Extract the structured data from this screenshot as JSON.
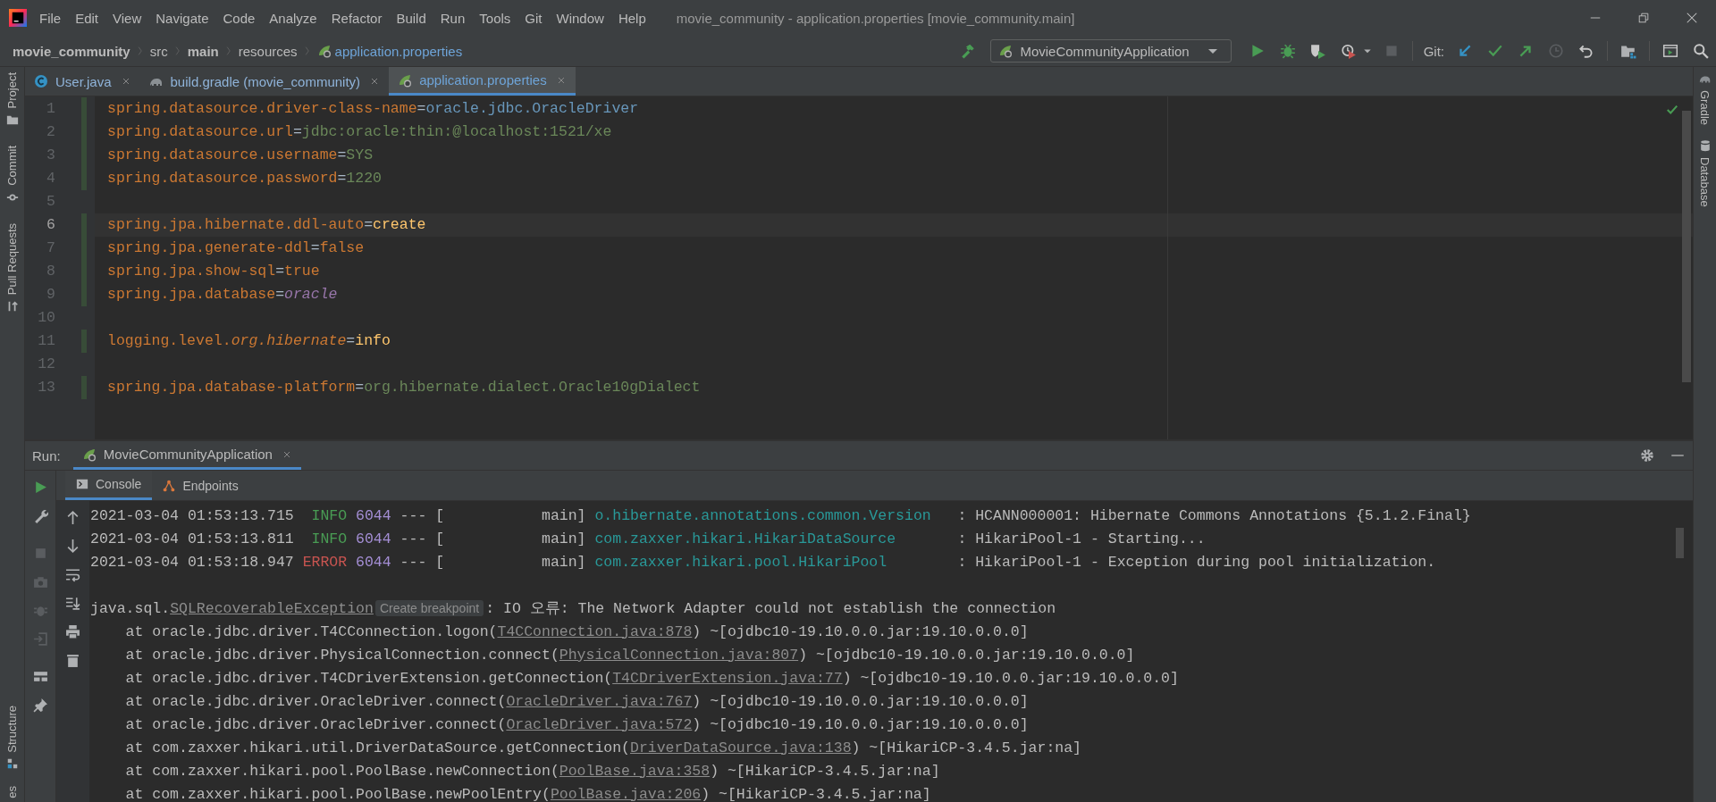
{
  "window": {
    "title": "movie_community - application.properties [movie_community.main]"
  },
  "menu": [
    "File",
    "Edit",
    "View",
    "Navigate",
    "Code",
    "Analyze",
    "Refactor",
    "Build",
    "Run",
    "Tools",
    "Git",
    "Window",
    "Help"
  ],
  "breadcrumbs": [
    {
      "label": "movie_community",
      "kind": "module"
    },
    {
      "label": "src",
      "kind": "folder"
    },
    {
      "label": "main",
      "kind": "source-set"
    },
    {
      "label": "resources",
      "kind": "folder"
    },
    {
      "label": "application.properties",
      "kind": "file"
    }
  ],
  "toolbar": {
    "run_configuration": "MovieCommunityApplication",
    "git_label": "Git:"
  },
  "left_stripe": [
    {
      "label": "Project"
    },
    {
      "label": "Commit"
    },
    {
      "label": "Pull Requests"
    },
    {
      "label": "Structure"
    },
    {
      "label": "es"
    }
  ],
  "right_stripe": [
    {
      "label": "Gradle"
    },
    {
      "label": "Database"
    }
  ],
  "editor_tabs": [
    {
      "label": "User.java",
      "kind": "java-class",
      "selected": false
    },
    {
      "label": "build.gradle (movie_community)",
      "kind": "gradle",
      "selected": false
    },
    {
      "label": "application.properties",
      "kind": "spring",
      "selected": true
    }
  ],
  "editor": {
    "lines": [
      {
        "number": "1",
        "modified": true,
        "selected": false,
        "segments": [
          {
            "text": "spring.datasource.driver-class-name",
            "kind": "key"
          },
          {
            "text": "=",
            "kind": "sep"
          },
          {
            "text": "oracle.jdbc.OracleDriver",
            "kind": "class"
          }
        ]
      },
      {
        "number": "2",
        "modified": true,
        "selected": false,
        "segments": [
          {
            "text": "spring.datasource.url",
            "kind": "key"
          },
          {
            "text": "=",
            "kind": "sep"
          },
          {
            "text": "jdbc:oracle:thin:@localhost:1521/xe",
            "kind": "value"
          }
        ]
      },
      {
        "number": "3",
        "modified": true,
        "selected": false,
        "segments": [
          {
            "text": "spring.datasource.username",
            "kind": "key"
          },
          {
            "text": "=",
            "kind": "sep"
          },
          {
            "text": "SYS",
            "kind": "value"
          }
        ]
      },
      {
        "number": "4",
        "modified": true,
        "selected": false,
        "segments": [
          {
            "text": "spring.datasource.password",
            "kind": "key"
          },
          {
            "text": "=",
            "kind": "sep"
          },
          {
            "text": "1220",
            "kind": "value"
          }
        ]
      },
      {
        "number": "5",
        "modified": false,
        "selected": false
      },
      {
        "number": "6",
        "modified": true,
        "selected": true,
        "segments": [
          {
            "text": "spring.jpa.hibernate.ddl-auto",
            "kind": "key"
          },
          {
            "text": "=",
            "kind": "sep"
          },
          {
            "text": "create",
            "kind": "keyword"
          }
        ]
      },
      {
        "number": "7",
        "modified": true,
        "selected": false,
        "segments": [
          {
            "text": "spring.jpa.generate-ddl",
            "kind": "key"
          },
          {
            "text": "=",
            "kind": "sep"
          },
          {
            "text": "false",
            "kind": "bool"
          }
        ]
      },
      {
        "number": "8",
        "modified": true,
        "selected": false,
        "segments": [
          {
            "text": "spring.jpa.show-sql",
            "kind": "key"
          },
          {
            "text": "=",
            "kind": "sep"
          },
          {
            "text": "true",
            "kind": "bool"
          }
        ]
      },
      {
        "number": "9",
        "modified": true,
        "selected": false,
        "segments": [
          {
            "text": "spring.jpa.database",
            "kind": "key"
          },
          {
            "text": "=",
            "kind": "sep"
          },
          {
            "text": "oracle",
            "kind": "enum"
          }
        ]
      },
      {
        "number": "10",
        "modified": false,
        "selected": false
      },
      {
        "number": "11",
        "modified": true,
        "selected": false,
        "segments": [
          {
            "text": "logging.level.",
            "kind": "key"
          },
          {
            "text": "org.hibernate",
            "kind": "key-italic"
          },
          {
            "text": "=",
            "kind": "sep"
          },
          {
            "text": "info",
            "kind": "keyword"
          }
        ]
      },
      {
        "number": "12",
        "modified": false,
        "selected": false
      },
      {
        "number": "13",
        "modified": true,
        "selected": false,
        "segments": [
          {
            "text": "spring.jpa.database-platform",
            "kind": "key"
          },
          {
            "text": "=",
            "kind": "sep"
          },
          {
            "text": "org.hibernate.dialect.Oracle10gDialect",
            "kind": "value"
          }
        ]
      }
    ]
  },
  "run_panel": {
    "label": "Run:",
    "tab": "MovieCommunityApplication",
    "subtabs": [
      {
        "label": "Console",
        "selected": true
      },
      {
        "label": "Endpoints",
        "selected": false
      }
    ],
    "console": [
      {
        "segments": [
          {
            "text": "2021-03-04 01:53:13.715  ",
            "kind": "plain"
          },
          {
            "text": "INFO",
            "kind": "info"
          },
          {
            "text": " 6044",
            "kind": "pid"
          },
          {
            "text": " --- [           main] ",
            "kind": "plain"
          },
          {
            "text": "o.hibernate.annotations.common.Version",
            "kind": "logger"
          },
          {
            "text": "   : HCANN000001: Hibernate Commons Annotations {5.1.2.Final}",
            "kind": "plain"
          }
        ]
      },
      {
        "segments": [
          {
            "text": "2021-03-04 01:53:13.811  ",
            "kind": "plain"
          },
          {
            "text": "INFO",
            "kind": "info"
          },
          {
            "text": " 6044",
            "kind": "pid"
          },
          {
            "text": " --- [           main] ",
            "kind": "plain"
          },
          {
            "text": "com.zaxxer.hikari.HikariDataSource",
            "kind": "logger"
          },
          {
            "text": "       : HikariPool-1 - Starting...",
            "kind": "plain"
          }
        ]
      },
      {
        "segments": [
          {
            "text": "2021-03-04 01:53:18.947 ",
            "kind": "plain"
          },
          {
            "text": "ERROR",
            "kind": "error"
          },
          {
            "text": " 6044",
            "kind": "pid"
          },
          {
            "text": " --- [           main] ",
            "kind": "plain"
          },
          {
            "text": "com.zaxxer.hikari.pool.HikariPool",
            "kind": "logger"
          },
          {
            "text": "        : HikariPool-1 - Exception during pool initialization.",
            "kind": "plain"
          }
        ]
      },
      {
        "gap_before": true,
        "segments": [
          {
            "text": "java.sql.",
            "kind": "plain"
          },
          {
            "text": "SQLRecoverableException",
            "kind": "link"
          },
          {
            "text": "Create breakpoint",
            "kind": "hint"
          },
          {
            "text": ": IO 오류: The Network Adapter could not establish the connection",
            "kind": "plain"
          }
        ]
      },
      {
        "segments": [
          {
            "text": "    at oracle.jdbc.driver.T4CConnection.logon(",
            "kind": "plain"
          },
          {
            "text": "T4CConnection.java:878",
            "kind": "link"
          },
          {
            "text": ") ~[ojdbc10-19.10.0.0.jar:19.10.0.0.0]",
            "kind": "plain"
          }
        ]
      },
      {
        "segments": [
          {
            "text": "    at oracle.jdbc.driver.PhysicalConnection.connect(",
            "kind": "plain"
          },
          {
            "text": "PhysicalConnection.java:807",
            "kind": "link"
          },
          {
            "text": ") ~[ojdbc10-19.10.0.0.jar:19.10.0.0.0]",
            "kind": "plain"
          }
        ]
      },
      {
        "segments": [
          {
            "text": "    at oracle.jdbc.driver.T4CDriverExtension.getConnection(",
            "kind": "plain"
          },
          {
            "text": "T4CDriverExtension.java:77",
            "kind": "link"
          },
          {
            "text": ") ~[ojdbc10-19.10.0.0.jar:19.10.0.0.0]",
            "kind": "plain"
          }
        ]
      },
      {
        "segments": [
          {
            "text": "    at oracle.jdbc.driver.OracleDriver.connect(",
            "kind": "plain"
          },
          {
            "text": "OracleDriver.java:767",
            "kind": "link"
          },
          {
            "text": ") ~[ojdbc10-19.10.0.0.jar:19.10.0.0.0]",
            "kind": "plain"
          }
        ]
      },
      {
        "segments": [
          {
            "text": "    at oracle.jdbc.driver.OracleDriver.connect(",
            "kind": "plain"
          },
          {
            "text": "OracleDriver.java:572",
            "kind": "link"
          },
          {
            "text": ") ~[ojdbc10-19.10.0.0.jar:19.10.0.0.0]",
            "kind": "plain"
          }
        ]
      },
      {
        "segments": [
          {
            "text": "    at com.zaxxer.hikari.util.DriverDataSource.getConnection(",
            "kind": "plain"
          },
          {
            "text": "DriverDataSource.java:138",
            "kind": "link"
          },
          {
            "text": ") ~[HikariCP-3.4.5.jar:na]",
            "kind": "plain"
          }
        ]
      },
      {
        "segments": [
          {
            "text": "    at com.zaxxer.hikari.pool.PoolBase.newConnection(",
            "kind": "plain"
          },
          {
            "text": "PoolBase.java:358",
            "kind": "link"
          },
          {
            "text": ") ~[HikariCP-3.4.5.jar:na]",
            "kind": "plain"
          }
        ]
      },
      {
        "segments": [
          {
            "text": "    at com.zaxxer.hikari.pool.PoolBase.newPoolEntry(",
            "kind": "plain"
          },
          {
            "text": "PoolBase.java:206",
            "kind": "link"
          },
          {
            "text": ") ~[HikariCP-3.4.5.jar:na]",
            "kind": "plain"
          }
        ]
      }
    ]
  }
}
